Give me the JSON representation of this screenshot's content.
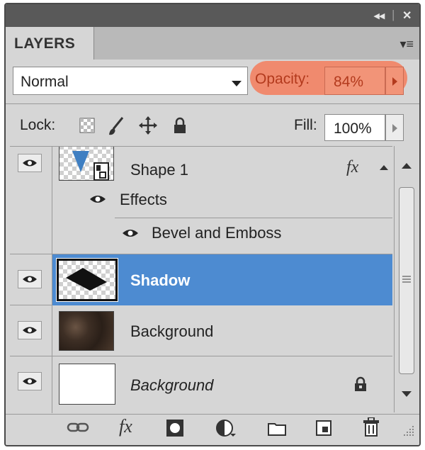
{
  "titlebar": {
    "collapse_glyph": "◂◂",
    "close_glyph": "✕"
  },
  "panel": {
    "tab_label": "LAYERS",
    "menu_glyph": "▾≡"
  },
  "blend_mode": {
    "value": "Normal"
  },
  "opacity": {
    "label": "Opacity:",
    "value": "84%",
    "highlight_color": "#f08a6e"
  },
  "lock": {
    "label": "Lock:"
  },
  "fill": {
    "label": "Fill:",
    "value": "100%"
  },
  "layers": [
    {
      "name": "Shape 1",
      "fx_label": "fx",
      "selected": false,
      "effects_label": "Effects",
      "effect_items": [
        "Bevel and Emboss"
      ]
    },
    {
      "name": "Shadow",
      "selected": true
    },
    {
      "name": "Background",
      "selected": false
    },
    {
      "name": "Background",
      "selected": false,
      "italic": true,
      "locked": true
    }
  ],
  "colors": {
    "selection": "#4d8bd1",
    "panel_bg": "#d6d6d6",
    "titlebar": "#595959"
  },
  "footer": {
    "icons": [
      "link-layers-icon",
      "add-style-icon",
      "add-mask-icon",
      "adjustment-layer-icon",
      "new-group-icon",
      "new-layer-icon",
      "delete-layer-icon"
    ],
    "fx_label": "fx"
  }
}
